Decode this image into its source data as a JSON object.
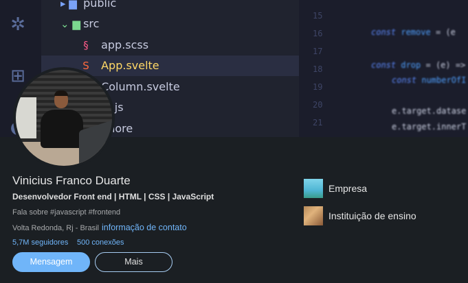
{
  "banner": {
    "tree": [
      {
        "icon": "folder-icon",
        "glyph": "▸",
        "label": "public"
      },
      {
        "icon": "folder-open-icon",
        "glyph": "⌄",
        "label": "src"
      },
      {
        "icon": "sass-file-icon",
        "glyph": "§",
        "label": "app.scss"
      },
      {
        "icon": "svelte-file-icon",
        "glyph": "S",
        "label": "App.svelte"
      },
      {
        "icon": "svelte-file-icon",
        "glyph": "S",
        "label": "Column.svelte"
      },
      {
        "icon": "js-file-icon",
        "glyph": "J",
        "label": "in.js"
      },
      {
        "icon": "gitignore-file-icon",
        "glyph": "◆",
        "label": "gnore"
      }
    ],
    "line_numbers": [
      "15",
      "16",
      "17",
      "18",
      "19",
      "20",
      "21"
    ],
    "code": [
      {
        "kw": "const",
        "name": "remove",
        "rest": " = (e"
      },
      {
        "kw": "const",
        "name": "drop",
        "rest": " = (e) =>"
      },
      {
        "kw": "const",
        "name": "numberOfI",
        "rest": ""
      },
      {
        "kw": "",
        "name": "",
        "rest": "e.target.datase"
      },
      {
        "kw": "",
        "name": "",
        "rest": "e.target.innerT"
      }
    ]
  },
  "profile": {
    "name": "Vinicius Franco Duarte",
    "headline": "Desenvolvedor Front end | HTML | CSS | JavaScript",
    "about": "Fala sobre #javascript #frontend",
    "location": "Volta Redonda, Rj - Brasil",
    "contact_link": "informação de contato",
    "followers": "5,7M seguidores",
    "connections": "500 conexões",
    "message_button": "Mensagem",
    "more_button": "Mais"
  },
  "organizations": {
    "company": "Empresa",
    "school": "Instituição de ensino"
  },
  "colors": {
    "accent": "#70b5f9",
    "background": "#1b1f23",
    "text": "#e6e6e6",
    "muted": "#a7a9ab"
  }
}
